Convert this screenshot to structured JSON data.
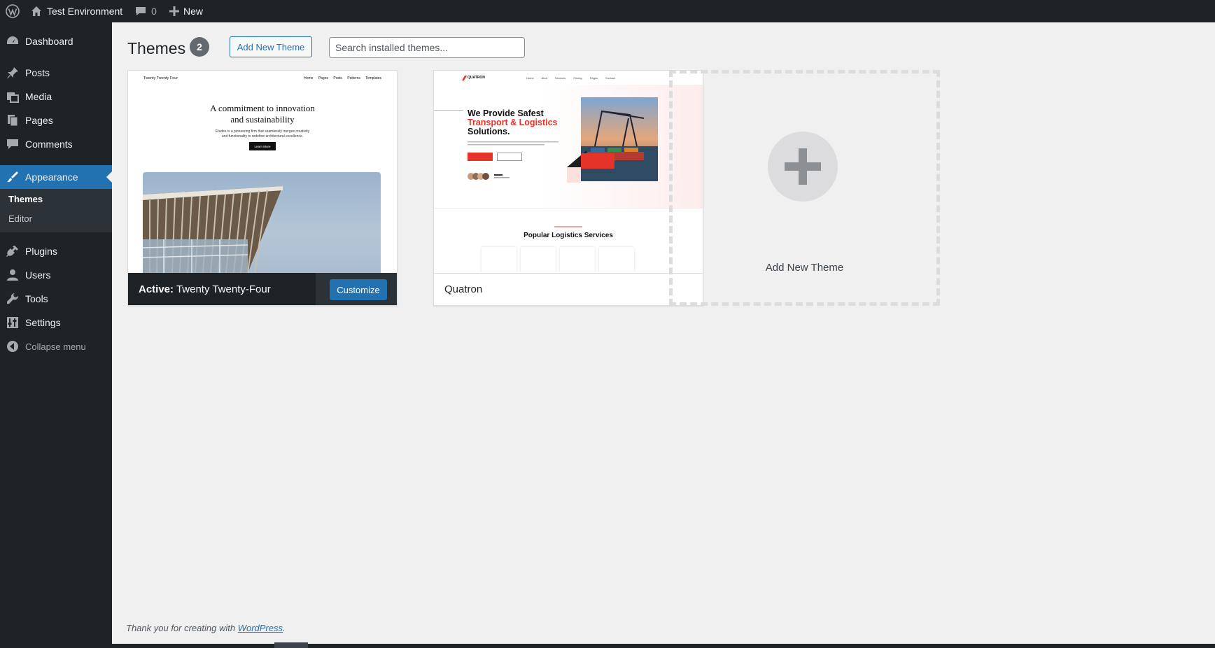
{
  "adminbar": {
    "site_name": "Test Environment",
    "comments_count": "0",
    "new_label": "New"
  },
  "sidebar": {
    "items": [
      {
        "label": "Dashboard",
        "icon": "dashboard-icon"
      },
      {
        "label": "Posts",
        "icon": "pin-icon"
      },
      {
        "label": "Media",
        "icon": "media-icon"
      },
      {
        "label": "Pages",
        "icon": "pages-icon"
      },
      {
        "label": "Comments",
        "icon": "comment-icon"
      },
      {
        "label": "Appearance",
        "icon": "brush-icon"
      },
      {
        "label": "Plugins",
        "icon": "plugin-icon"
      },
      {
        "label": "Users",
        "icon": "user-icon"
      },
      {
        "label": "Tools",
        "icon": "wrench-icon"
      },
      {
        "label": "Settings",
        "icon": "settings-icon"
      }
    ],
    "submenu": [
      {
        "label": "Themes"
      },
      {
        "label": "Editor"
      }
    ],
    "collapse_label": "Collapse menu"
  },
  "main": {
    "title": "Themes",
    "count": "2",
    "add_button": "Add New Theme",
    "search_placeholder": "Search installed themes...",
    "themes": [
      {
        "active_prefix": "Active:",
        "name": "Twenty Twenty-Four",
        "customize_label": "Customize",
        "preview": {
          "brand": "Twenty Twenty Four",
          "nav": "Home Pages Posts Patterns Templates",
          "heading_line1": "A commitment to innovation",
          "heading_line2": "and sustainability",
          "text_line1": "Études is a pioneering firm that seamlessly merges creativity",
          "text_line2": "and functionality to redefine architectural excellence.",
          "button": "Learn More"
        }
      },
      {
        "name": "Quatron",
        "preview": {
          "logo": "QUATRON",
          "nav": "Home Abut Services Pricing Pages Contact",
          "heading_line1": "We Provide Safest",
          "heading_line2": "Transport & Logistics",
          "heading_line3": "Solutions.",
          "section_title": "Popular Logistics Services"
        }
      }
    ],
    "add_tile_label": "Add New Theme"
  },
  "footer": {
    "text": "Thank you for creating with",
    "link": "WordPress",
    "suffix": "."
  },
  "colors": {
    "admin_dark": "#1d2327",
    "accent": "#2271b1",
    "quatron_red": "#e5332a"
  }
}
